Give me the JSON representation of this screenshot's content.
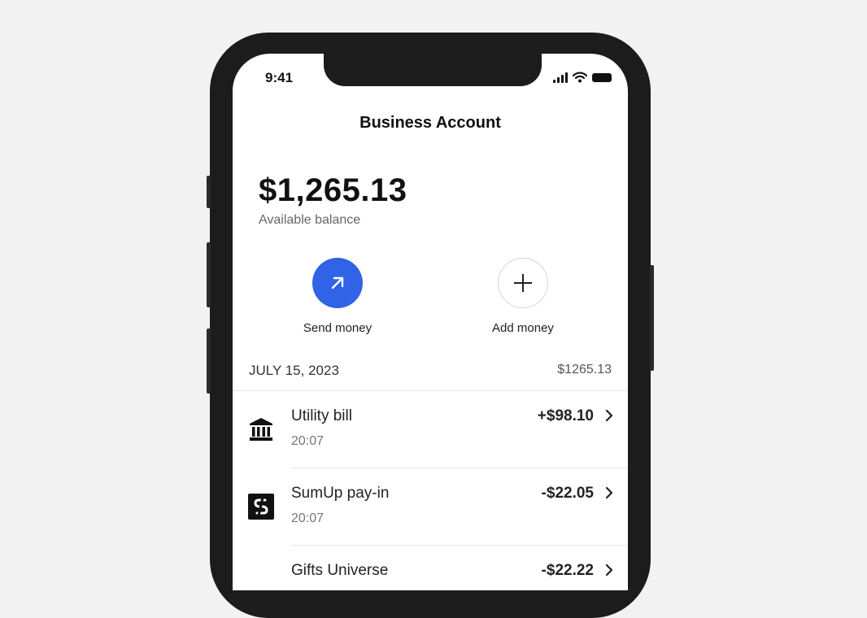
{
  "status_bar": {
    "time": "9:41"
  },
  "header": {
    "title": "Business Account"
  },
  "balance": {
    "amount": "$1,265.13",
    "label": "Available balance"
  },
  "actions": [
    {
      "label": "Send money",
      "icon": "arrow-up-right-icon",
      "color": "#3063e6"
    },
    {
      "label": "Add money",
      "icon": "plus-icon"
    }
  ],
  "transactions_section": {
    "date": "JULY 15, 2023",
    "total": "$1265.13"
  },
  "transactions": [
    {
      "name": "Utility bill",
      "time": "20:07",
      "amount": "+$98.10",
      "icon": "bank-icon"
    },
    {
      "name": "SumUp pay-in",
      "time": "20:07",
      "amount": "-$22.05",
      "icon": "sumup-logo-icon"
    },
    {
      "name": "Gifts Universe",
      "time": "",
      "amount": "-$22.22",
      "icon": "gift-icon"
    }
  ]
}
